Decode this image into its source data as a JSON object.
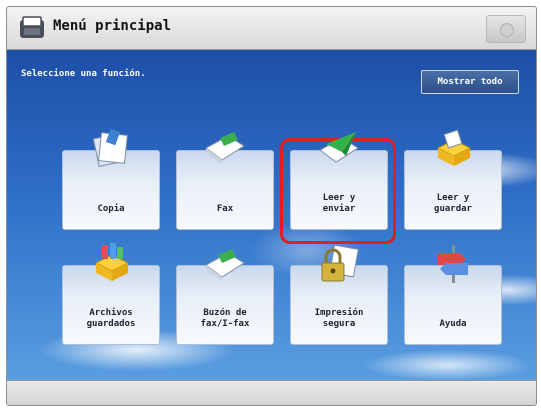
{
  "header": {
    "title": "Menú principal"
  },
  "main": {
    "subtitle": "Seleccione una función.",
    "show_all_label": "Mostrar todo",
    "tiles": [
      {
        "label": "Copia",
        "icon": "copy-icon"
      },
      {
        "label": "Fax",
        "icon": "fax-icon"
      },
      {
        "label": "Leer y\nenviar",
        "icon": "scan-send-icon",
        "highlighted": true
      },
      {
        "label": "Leer y\nguardar",
        "icon": "scan-store-icon"
      },
      {
        "label": "Archivos\nguardados",
        "icon": "stored-files-icon"
      },
      {
        "label": "Buzón de\nfax/I-fax",
        "icon": "fax-inbox-icon"
      },
      {
        "label": "Impresión\nsegura",
        "icon": "secure-print-icon"
      },
      {
        "label": "Ayuda",
        "icon": "help-icon"
      }
    ]
  },
  "colors": {
    "highlight": "#e02020",
    "sky": "#2f6fc8"
  }
}
